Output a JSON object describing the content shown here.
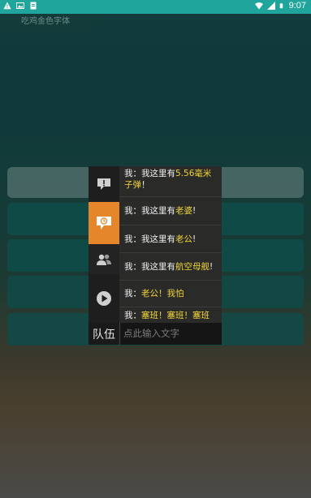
{
  "status_bar": {
    "time": "9:07",
    "left_icons": [
      "warning-icon",
      "image-icon",
      "document-icon"
    ],
    "right_icons": [
      "wifi-icon",
      "signal-icon",
      "battery-icon"
    ]
  },
  "app": {
    "title": "吃鸡金色字体"
  },
  "popup": {
    "tabs": [
      {
        "icon": "alert-icon"
      },
      {
        "icon": "clock-icon"
      },
      {
        "icon": "people-icon"
      },
      {
        "icon": "play-icon"
      },
      {
        "label": "队伍"
      }
    ],
    "messages": [
      {
        "prefix": "我：我这里有",
        "highlight": "5.56毫米子弹",
        "suffix": "！"
      },
      {
        "prefix": "我：我这里有",
        "highlight": "老婆",
        "suffix": "!"
      },
      {
        "prefix": "我：我这里有",
        "highlight": "老公",
        "suffix": "!"
      },
      {
        "prefix": "我：我这里有",
        "highlight": "航空母舰",
        "suffix": "!"
      },
      {
        "prefix": "我：",
        "highlight": "老公！我怕",
        "suffix": ""
      },
      {
        "prefix": "我：",
        "highlight": "塞班！塞班！塞班",
        "suffix": ""
      }
    ],
    "input_placeholder": "点此输入文字"
  },
  "colors": {
    "status_bar": "#1fa59b",
    "active_tab": "#e6862a",
    "highlight_text": "#f0d33a"
  }
}
